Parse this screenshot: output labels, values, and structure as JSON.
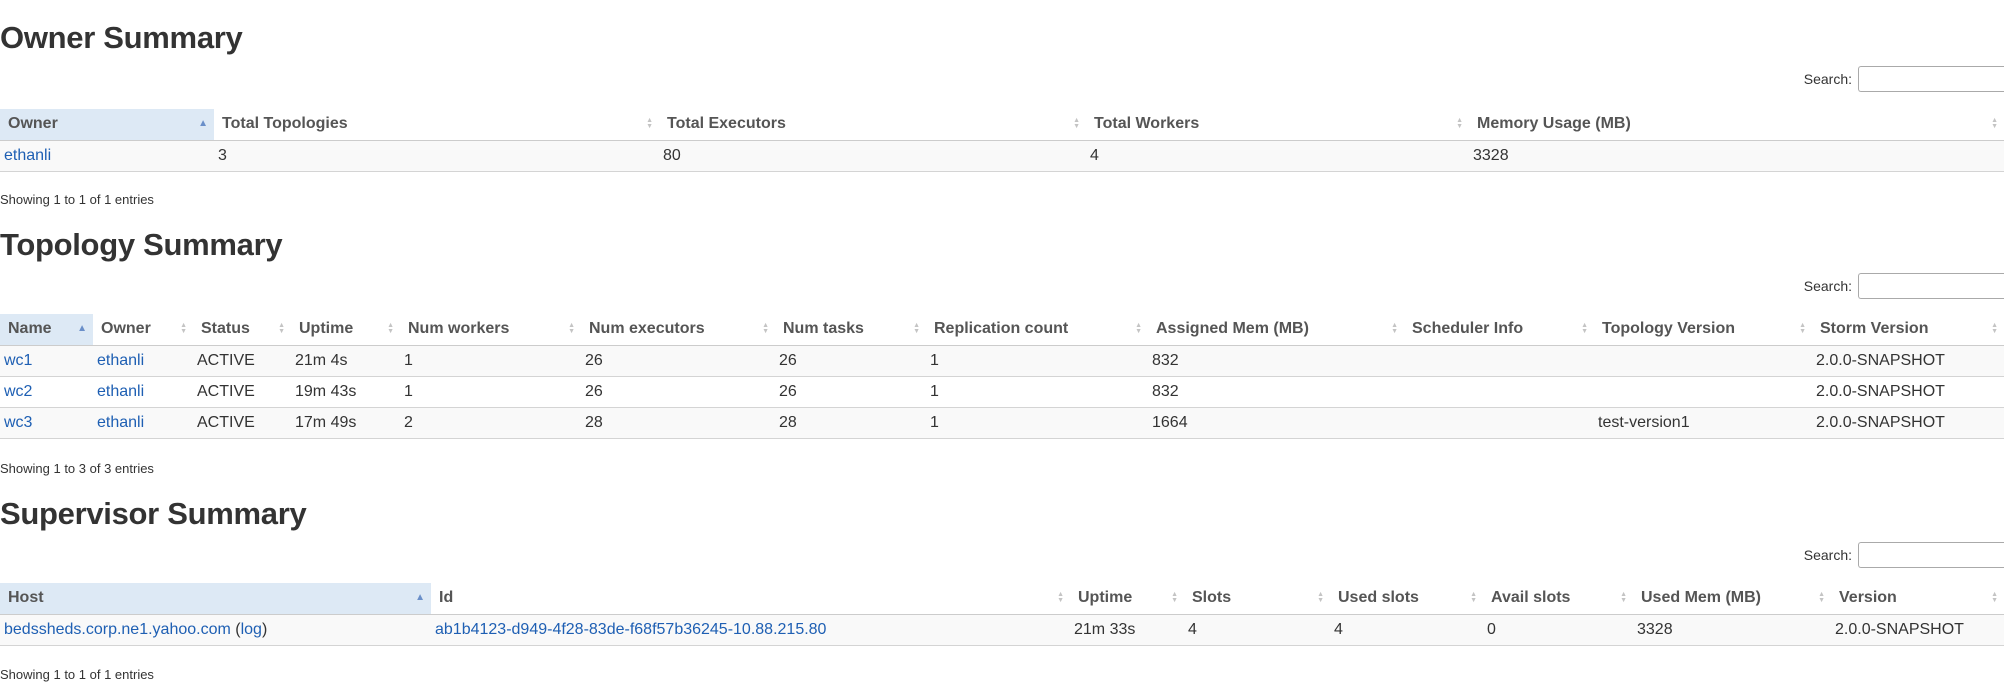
{
  "search_label": "Search:",
  "owner_summary": {
    "title": "Owner Summary",
    "columns": [
      "Owner",
      "Total Topologies",
      "Total Executors",
      "Total Workers",
      "Memory Usage (MB)"
    ],
    "rows": [
      {
        "owner": "ethanli",
        "topologies": "3",
        "executors": "80",
        "workers": "4",
        "memory": "3328"
      }
    ],
    "info": "Showing 1 to 1 of 1 entries"
  },
  "topology_summary": {
    "title": "Topology Summary",
    "columns": [
      "Name",
      "Owner",
      "Status",
      "Uptime",
      "Num workers",
      "Num executors",
      "Num tasks",
      "Replication count",
      "Assigned Mem (MB)",
      "Scheduler Info",
      "Topology Version",
      "Storm Version"
    ],
    "rows": [
      {
        "name": "wc1",
        "owner": "ethanli",
        "status": "ACTIVE",
        "uptime": "21m 4s",
        "workers": "1",
        "executors": "26",
        "tasks": "26",
        "replication": "1",
        "mem": "832",
        "scheduler": "",
        "version": "",
        "storm": "2.0.0-SNAPSHOT"
      },
      {
        "name": "wc2",
        "owner": "ethanli",
        "status": "ACTIVE",
        "uptime": "19m 43s",
        "workers": "1",
        "executors": "26",
        "tasks": "26",
        "replication": "1",
        "mem": "832",
        "scheduler": "",
        "version": "",
        "storm": "2.0.0-SNAPSHOT"
      },
      {
        "name": "wc3",
        "owner": "ethanli",
        "status": "ACTIVE",
        "uptime": "17m 49s",
        "workers": "2",
        "executors": "28",
        "tasks": "28",
        "replication": "1",
        "mem": "1664",
        "scheduler": "",
        "version": "test-version1",
        "storm": "2.0.0-SNAPSHOT"
      }
    ],
    "info": "Showing 1 to 3 of 3 entries"
  },
  "supervisor_summary": {
    "title": "Supervisor Summary",
    "columns": [
      "Host",
      "Id",
      "Uptime",
      "Slots",
      "Used slots",
      "Avail slots",
      "Used Mem (MB)",
      "Version"
    ],
    "rows": [
      {
        "host": "bedssheds.corp.ne1.yahoo.com",
        "log_label": "log",
        "id": "ab1b4123-d949-4f28-83de-f68f57b36245-10.88.215.80",
        "uptime": "21m 33s",
        "slots": "4",
        "used_slots": "4",
        "avail_slots": "0",
        "used_mem": "3328",
        "version": "2.0.0-SNAPSHOT"
      }
    ],
    "info": "Showing 1 to 1 of 1 entries"
  }
}
